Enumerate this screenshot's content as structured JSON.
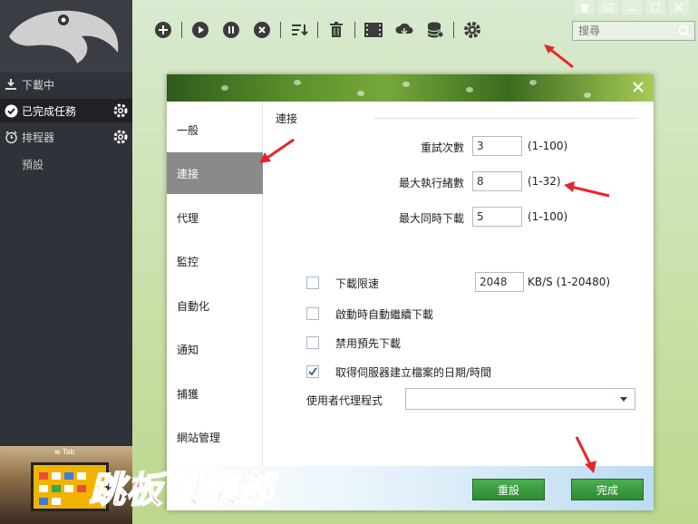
{
  "sidebar": {
    "items": [
      {
        "label": "下載中"
      },
      {
        "label": "已完成任務"
      },
      {
        "label": "排程器"
      }
    ],
    "sub_item": "預設",
    "ad_caption": "w Tab"
  },
  "toolbar": {
    "buttons": [
      "add-icon",
      "play-icon",
      "pause-icon",
      "stop-icon",
      "sort-icon",
      "trash-icon",
      "video-icon",
      "cloud-download-icon",
      "database-icon",
      "gear-icon"
    ]
  },
  "search": {
    "placeholder": "搜尋"
  },
  "dialog": {
    "nav": [
      {
        "label": "一般"
      },
      {
        "label": "連接"
      },
      {
        "label": "代理"
      },
      {
        "label": "監控"
      },
      {
        "label": "自動化"
      },
      {
        "label": "通知"
      },
      {
        "label": "捕獲"
      },
      {
        "label": "網站管理"
      }
    ],
    "section_title": "連接",
    "fields": [
      {
        "label": "重試次數",
        "value": "3",
        "range": "(1-100)"
      },
      {
        "label": "最大執行緒數",
        "value": "8",
        "range": "(1-32)"
      },
      {
        "label": "最大同時下載",
        "value": "5",
        "range": "(1-100)"
      }
    ],
    "checks": [
      {
        "label": "下載限速",
        "checked": false
      },
      {
        "label": "啟動時自動繼續下載",
        "checked": false
      },
      {
        "label": "禁用預先下載",
        "checked": false
      },
      {
        "label": "取得伺服器建立檔案的日期/時間",
        "checked": true
      }
    ],
    "rate": {
      "value": "2048",
      "unit": "KB/S (1-20480)"
    },
    "ua_label": "使用者代理程式",
    "ua_value": "",
    "reset_label": "重設",
    "done_label": "完成"
  },
  "watermark": "跳板俱樂部",
  "colors": {
    "accent_green": "#2e8b32",
    "annotation_red": "#e8242b",
    "sidebar_bg": "#2f3238"
  }
}
